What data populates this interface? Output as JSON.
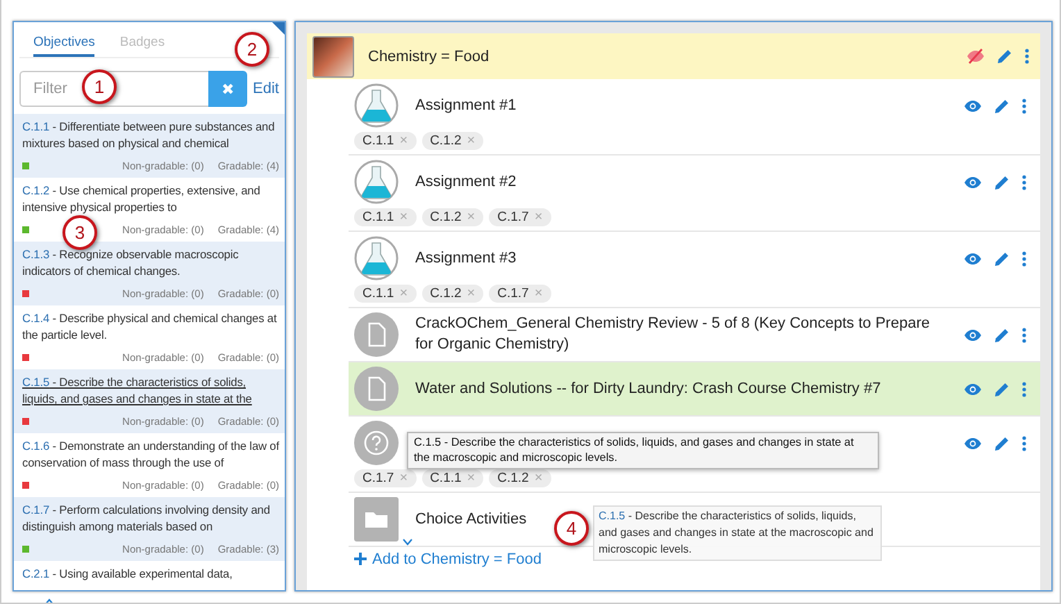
{
  "objectives_panel": {
    "tabs": [
      {
        "label": "Objectives",
        "selected": true
      },
      {
        "label": "Badges",
        "selected": false
      }
    ],
    "filter": {
      "placeholder": "Filter"
    },
    "clear_button": "✖",
    "edit_link": "Edit",
    "objectives": [
      {
        "code": "C.1.1",
        "description": " - Differentiate between pure substances and mixtures based on physical and chemical",
        "color": "#5cb82e",
        "non_gradable": "Non-gradable: (0)",
        "gradable": "Gradable: (4)",
        "dragging": false
      },
      {
        "code": "C.1.2",
        "description": " - Use chemical properties, extensive, and intensive physical properties to",
        "color": "#5cb82e",
        "non_gradable": "Non-gradable: (0)",
        "gradable": "Gradable: (4)",
        "dragging": false
      },
      {
        "code": "C.1.3",
        "description": " - Recognize observable macroscopic indicators of chemical changes.",
        "color": "#e8393e",
        "non_gradable": "Non-gradable: (0)",
        "gradable": "Gradable: (0)",
        "dragging": false
      },
      {
        "code": "C.1.4",
        "description": " - Describe physical and chemical changes at the particle level.",
        "color": "#e8393e",
        "non_gradable": "Non-gradable: (0)",
        "gradable": "Gradable: (0)",
        "dragging": false
      },
      {
        "code": "C.1.5",
        "description": " - Describe the characteristics of solids, liquids, and gases and changes in state at the",
        "color": "#e8393e",
        "non_gradable": "Non-gradable: (0)",
        "gradable": "Gradable: (0)",
        "dragging": true
      },
      {
        "code": "C.1.6",
        "description": " - Demonstrate an understanding of the law of conservation of mass through the use of",
        "color": "#e8393e",
        "non_gradable": "Non-gradable: (0)",
        "gradable": "Gradable: (0)",
        "dragging": false
      },
      {
        "code": "C.1.7",
        "description": " - Perform calculations involving density and distinguish among materials based on",
        "color": "#5cb82e",
        "non_gradable": "Non-gradable: (0)",
        "gradable": "Gradable: (3)",
        "dragging": false
      },
      {
        "code": "C.2.1",
        "description": " - Using available experimental data,",
        "dragging": false
      }
    ]
  },
  "module_panel": {
    "module": {
      "title": "Chemistry = Food",
      "hidden": true,
      "expanded": true,
      "items": [
        {
          "kind": "assignment",
          "title": "Assignment #1",
          "hidden": false,
          "selected": false,
          "tags": [
            "C.1.1",
            "C.1.2"
          ]
        },
        {
          "kind": "assignment",
          "title": "Assignment #2",
          "hidden": false,
          "selected": false,
          "tags": [
            "C.1.1",
            "C.1.2",
            "C.1.7"
          ]
        },
        {
          "kind": "assignment",
          "title": "Assignment #3",
          "hidden": false,
          "selected": false,
          "tags": [
            "C.1.1",
            "C.1.2",
            "C.1.7"
          ]
        },
        {
          "kind": "document",
          "title": "CrackOChem_General Chemistry Review - 5 of 8 (Key Concepts to Prepare for Organic Chemistry)",
          "hidden": false,
          "selected": false
        },
        {
          "kind": "document",
          "title": "Water and Solutions -- for Dirty Laundry: Crash Course Chemistry #7",
          "hidden": false,
          "selected": true
        },
        {
          "kind": "unknown",
          "hidden": false,
          "selected": false,
          "tags": [
            "C.1.7",
            "C.1.1",
            "C.1.2"
          ]
        },
        {
          "kind": "folder",
          "title": "Choice Activities",
          "expanded": false,
          "selected": false
        }
      ]
    },
    "remove_symbol": "×",
    "add_link": "Add to Chemistry = Food"
  },
  "drag_ghost": {
    "code": "C.1.5",
    "text": " - Describe the characteristics of solids, liquids, and gases and changes in state at the macroscopic and microscopic levels."
  },
  "tooltip": {
    "text": "C.1.5 - Describe the characteristics of solids, liquids, and gases and changes in state at the macroscopic and microscopic levels."
  },
  "callouts": [
    "1",
    "2",
    "3",
    "4"
  ]
}
